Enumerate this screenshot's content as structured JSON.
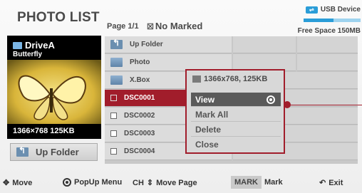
{
  "header": {
    "title": "PHOTO LIST",
    "page_info": "Page 1/1",
    "marked_status": "No Marked",
    "device_label": "USB Device",
    "free_space": "Free Space 150MB",
    "free_space_fraction": 0.52
  },
  "preview": {
    "drive": "DriveA",
    "filename": "Butterfly",
    "resolution": "1366×768  125KB"
  },
  "sidebar": {
    "up_folder_label": "Up Folder"
  },
  "file_list": {
    "rows": [
      {
        "name": "Up Folder",
        "type": "up-folder"
      },
      {
        "name": "Photo",
        "type": "folder"
      },
      {
        "name": "X.Box",
        "type": "folder"
      },
      {
        "name": "DSC0001",
        "type": "file",
        "selected": true
      },
      {
        "name": "DSC0002",
        "type": "file"
      },
      {
        "name": "DSC0003",
        "type": "file"
      },
      {
        "name": "DSC0004",
        "type": "file"
      }
    ]
  },
  "popup": {
    "info": "1366x768, 125KB",
    "items": [
      "View",
      "Mark All",
      "Delete",
      "Close"
    ]
  },
  "footer": {
    "move": "Move",
    "popup_menu": "PopUp Menu",
    "ch": "CH",
    "move_page": "Move Page",
    "mark_key": "MARK",
    "mark": "Mark",
    "exit": "Exit"
  },
  "colors": {
    "accent": "#a11d2b",
    "usb": "#2a9dd8"
  }
}
